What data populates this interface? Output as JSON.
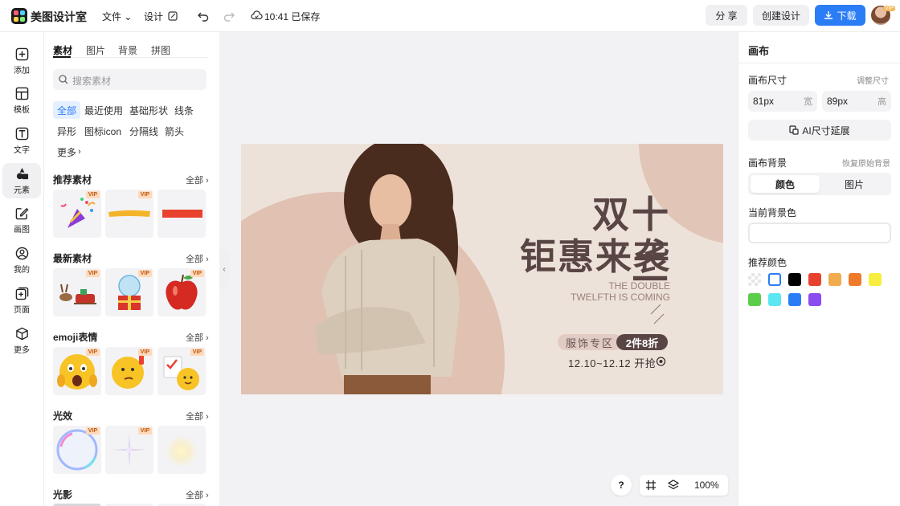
{
  "app": {
    "name": "美图设计室"
  },
  "header": {
    "menu_file": "文件",
    "menu_design": "设计",
    "save_status": "10:41 已保存",
    "share_label": "分 享",
    "create_label": "创建设计",
    "download_label": "下载",
    "vip_badge": "VIP"
  },
  "rail": {
    "items": [
      {
        "label": "添加",
        "icon": "plus-square-icon"
      },
      {
        "label": "模板",
        "icon": "template-icon"
      },
      {
        "label": "文字",
        "icon": "text-icon"
      },
      {
        "label": "元素",
        "icon": "element-icon"
      },
      {
        "label": "画图",
        "icon": "draw-icon"
      },
      {
        "label": "我的",
        "icon": "user-icon"
      },
      {
        "label": "页面",
        "icon": "page-icon"
      },
      {
        "label": "更多",
        "icon": "more-cube-icon"
      }
    ]
  },
  "panel": {
    "tabs": [
      "素材",
      "图片",
      "背景",
      "拼图"
    ],
    "search_placeholder": "搜索素材",
    "chips": [
      "全部",
      "最近使用",
      "基础形状",
      "线条",
      "异形",
      "图标icon",
      "分隔线",
      "箭头",
      "更多"
    ],
    "vip": "VIP",
    "see_all": "全部",
    "sections": [
      {
        "title": "推荐素材"
      },
      {
        "title": "最新素材"
      },
      {
        "title": "emoji表情"
      },
      {
        "title": "光效"
      },
      {
        "title": "光影"
      }
    ]
  },
  "artboard": {
    "headline_line1": "双十二",
    "headline_line2": "钜惠来袭",
    "english_line1": "THE DOUBLE",
    "english_line2": "TWELFTH IS COMING",
    "tag_zone": "服饰专区",
    "tag_discount": "2件8折",
    "date_text": "12.10~12.12  开抢"
  },
  "canvas_controls": {
    "help": "?",
    "zoom": "100%"
  },
  "right_panel": {
    "title": "画布",
    "size_label": "画布尺寸",
    "resize_link": "调整尺寸",
    "width_value": "81px",
    "width_unit": "宽",
    "height_value": "89px",
    "height_unit": "高",
    "ai_extend": "AI尺寸延展",
    "bg_label": "画布背景",
    "restore_link": "恢复原始背景",
    "seg_color": "颜色",
    "seg_image": "图片",
    "current_bg_label": "当前背景色",
    "recommended_label": "推荐颜色",
    "swatches": [
      "transparent",
      "#ffffff",
      "#000000",
      "#e8422f",
      "#f1ac4f",
      "#ee7a2a",
      "#f7ee3f",
      "#5bcd4a",
      "#5ce6f2",
      "#2b7df5",
      "#8a4bf0"
    ]
  }
}
